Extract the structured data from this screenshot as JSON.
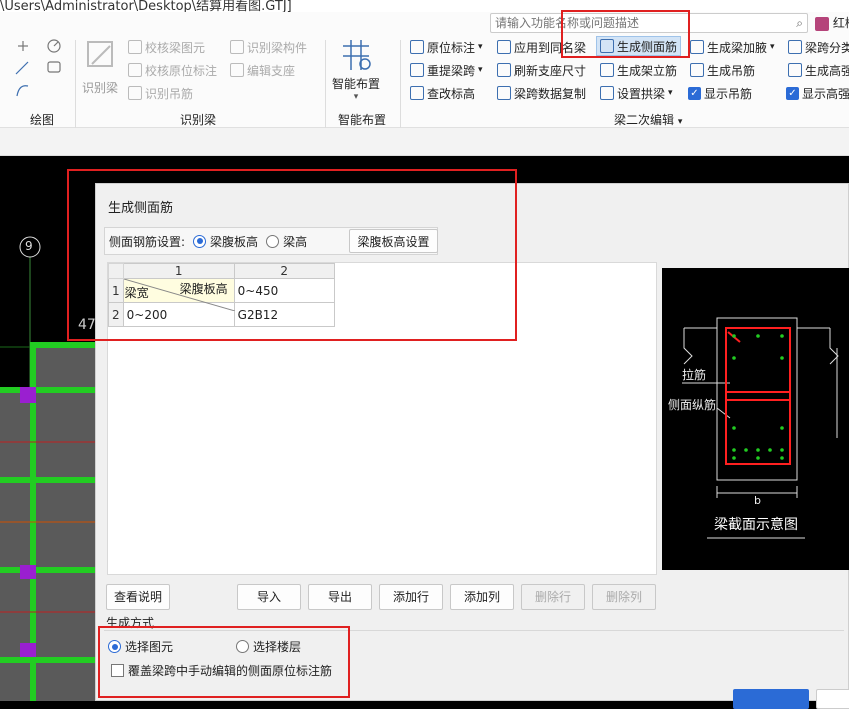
{
  "window": {
    "title_path": "\\Users\\Administrator\\Desktop\\结算用看图.GTJ]"
  },
  "search": {
    "placeholder": "请输入功能名称或问题描述"
  },
  "user": {
    "name": "红梅"
  },
  "ribbon": {
    "draw_group": {
      "label": "绘图"
    },
    "identify_beam_group": {
      "label": "识别梁",
      "big_button": "识别梁",
      "items": [
        "校核梁图元",
        "识别梁构件",
        "校核原位标注",
        "编辑支座",
        "识别吊筋"
      ]
    },
    "smart_layout_group": {
      "label": "智能布置",
      "big_button": "智能布置"
    },
    "beam_edit_group": {
      "label": "梁二次编辑",
      "col1": [
        "原位标注",
        "重提梁跨",
        "查改标高"
      ],
      "col2": [
        "应用到同名梁",
        "刷新支座尺寸",
        "梁跨数据复制"
      ],
      "col3": [
        "生成侧面筋",
        "生成架立筋",
        "设置拱梁"
      ],
      "col4": [
        "生成梁加腋",
        "生成吊筋",
        "显示吊筋"
      ],
      "col5": [
        "梁跨分类",
        "生成高强",
        "显示高强"
      ]
    }
  },
  "cad": {
    "axis_label": "9",
    "dim_text": "47"
  },
  "dialog": {
    "title": "生成侧面筋",
    "setting_label": "侧面钢筋设置:",
    "radio_web_height": "梁腹板高",
    "radio_beam_height": "梁高",
    "settings_button": "梁腹板高设置",
    "table": {
      "col_headers": [
        "1",
        "2"
      ],
      "row_headers": [
        "1",
        "2"
      ],
      "diag_top": "梁腹板高",
      "diag_bottom": "梁宽",
      "r1c2": "0~450",
      "r2c1": "0~200",
      "r2c2": "G2B12"
    },
    "preview": {
      "label_tie": "拉筋",
      "label_side": "侧面纵筋",
      "label_b": "b",
      "caption": "梁截面示意图"
    },
    "buttons": {
      "help": "查看说明",
      "import": "导入",
      "export": "导出",
      "add_row": "添加行",
      "add_col": "添加列",
      "del_row": "删除行",
      "del_col": "删除列"
    },
    "gen_section_label": "生成方式",
    "opt_select_element": "选择图元",
    "opt_select_floor": "选择楼层",
    "overwrite_label": "覆盖梁跨中手动编辑的侧面原位标注筋"
  }
}
